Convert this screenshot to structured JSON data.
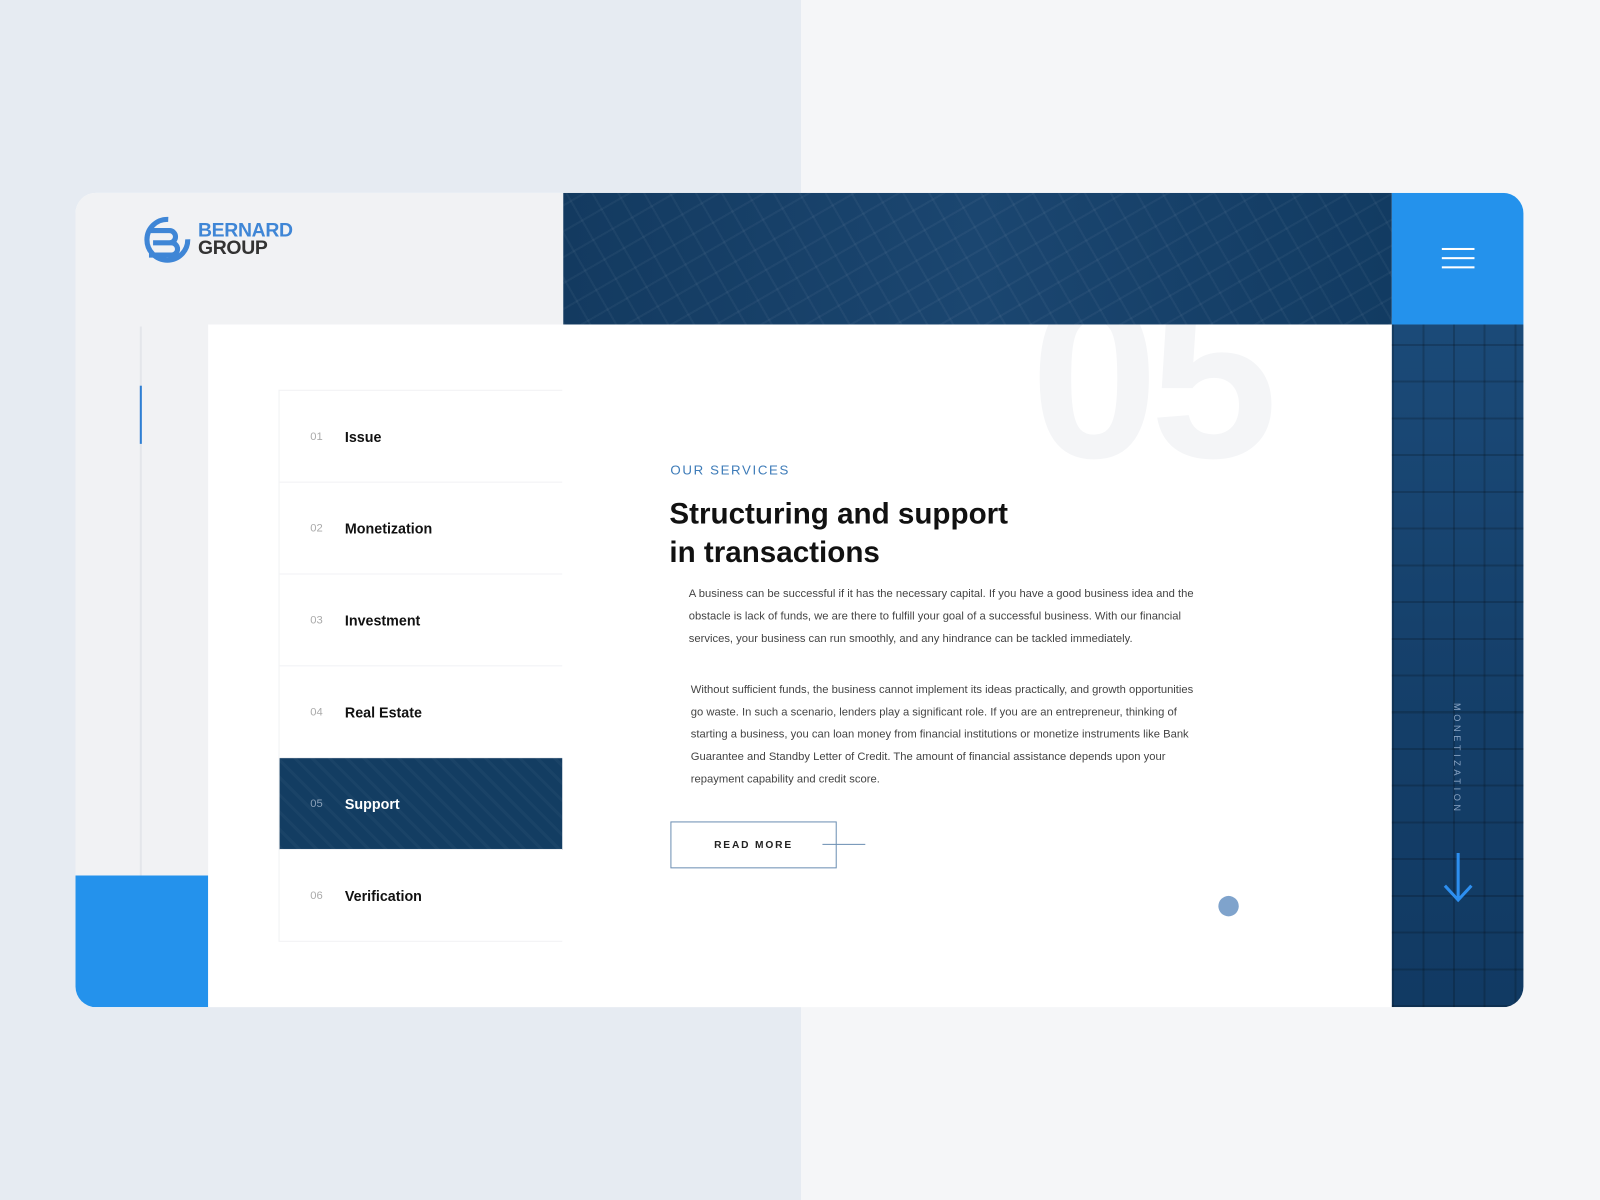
{
  "brand": {
    "line1": "BERNARD",
    "line2": "GROUP",
    "color": "#2492ec"
  },
  "menu_icon": "hamburger-icon",
  "nav": [
    {
      "num": "01",
      "label": "Issue"
    },
    {
      "num": "02",
      "label": "Monetization"
    },
    {
      "num": "03",
      "label": "Investment"
    },
    {
      "num": "04",
      "label": "Real Estate"
    },
    {
      "num": "05",
      "label": "Support",
      "active": true
    },
    {
      "num": "06",
      "label": "Verification"
    }
  ],
  "main": {
    "big_number": "05",
    "eyebrow": "OUR SERVICES",
    "heading_line1": "Structuring and support",
    "heading_line2": "in transactions",
    "paragraph1": "A business can be successful if it has the necessary capital. If you have a good business idea and the obstacle is lack of funds, we are there to fulfill your goal of a successful business. With our financial services, your business can run smoothly, and any hindrance can be tackled immediately.",
    "paragraph2": "Without sufficient funds, the business cannot implement its ideas practically, and growth opportunities go waste. In such a scenario, lenders play a significant role. If you are an entrepreneur, thinking of starting a business, you can loan money from financial institutions or monetize instruments like Bank Guarantee and Standby Letter of Credit. The amount of financial assistance depends upon your repayment capability and credit score.",
    "read_more": "READ MORE"
  },
  "side_label": "MONETIZATION"
}
